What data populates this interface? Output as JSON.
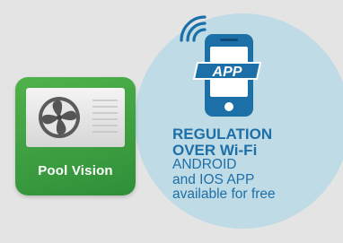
{
  "app_tile": {
    "label": "Pool Vision",
    "fan_icon": "fan-icon"
  },
  "badge": {
    "icon": "phone-icon",
    "signal_icon": "wifi-icon",
    "screen_text": "APP"
  },
  "text": {
    "heading_1": "REGULATION",
    "heading_2": "OVER Wi-Fi",
    "line_1": "ANDROID",
    "line_2": "and IOS APP",
    "line_3": "available for free"
  },
  "colors": {
    "background": "#e4e4e4",
    "circle": "#bfdbe6",
    "accent_blue": "#1d6fa8",
    "tile_green": "#3aa040"
  }
}
